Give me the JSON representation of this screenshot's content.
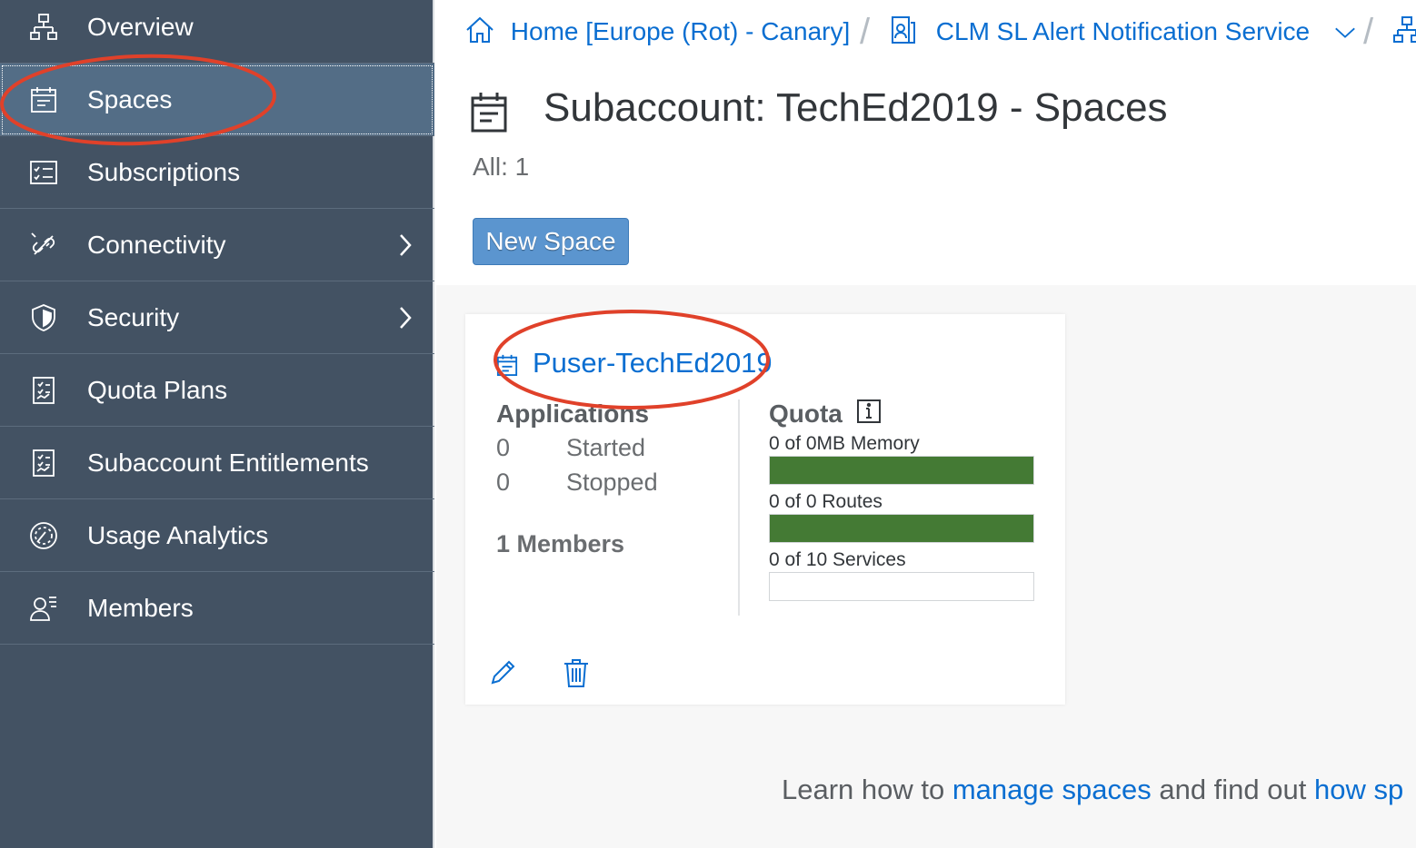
{
  "sidebar": {
    "items": [
      {
        "label": "Overview",
        "icon": "org-chart-icon"
      },
      {
        "label": "Spaces",
        "icon": "calendar-icon",
        "active": true
      },
      {
        "label": "Subscriptions",
        "icon": "checklist-icon"
      },
      {
        "label": "Connectivity",
        "icon": "disconnected-link-icon",
        "has_children": true
      },
      {
        "label": "Security",
        "icon": "shield-icon",
        "has_children": true
      },
      {
        "label": "Quota Plans",
        "icon": "document-chart-icon"
      },
      {
        "label": "Subaccount Entitlements",
        "icon": "document-chart-icon"
      },
      {
        "label": "Usage Analytics",
        "icon": "gauge-icon"
      },
      {
        "label": "Members",
        "icon": "person-list-icon"
      }
    ]
  },
  "breadcrumb": {
    "home": "Home [Europe (Rot) - Canary]",
    "global_account": "CLM SL Alert Notification Service",
    "separator": "/"
  },
  "header": {
    "title": "Subaccount: TechEd2019 - Spaces",
    "count": "All: 1",
    "new_space_label": "New Space"
  },
  "space_card": {
    "name": "Puser-TechEd2019",
    "applications_title": "Applications",
    "started_count": "0",
    "started_label": "Started",
    "stopped_count": "0",
    "stopped_label": "Stopped",
    "members": "1 Members",
    "quota_title": "Quota",
    "quota_memory": "0 of 0MB Memory",
    "quota_memory_fill": 1.0,
    "quota_routes": "0 of 0 Routes",
    "quota_routes_fill": 1.0,
    "quota_services": "0 of 10 Services",
    "quota_services_fill": 0.0
  },
  "footer": {
    "text_1": "Learn how to ",
    "link_1": "manage spaces",
    "text_2": " and find out ",
    "link_2": "how sp"
  },
  "colors": {
    "sidebar_bg": "#435263",
    "sidebar_active": "#536d86",
    "link": "#0a6ed1",
    "quota_fill": "#447a34",
    "button": "#5b95cf",
    "annotation": "#e0412a"
  }
}
